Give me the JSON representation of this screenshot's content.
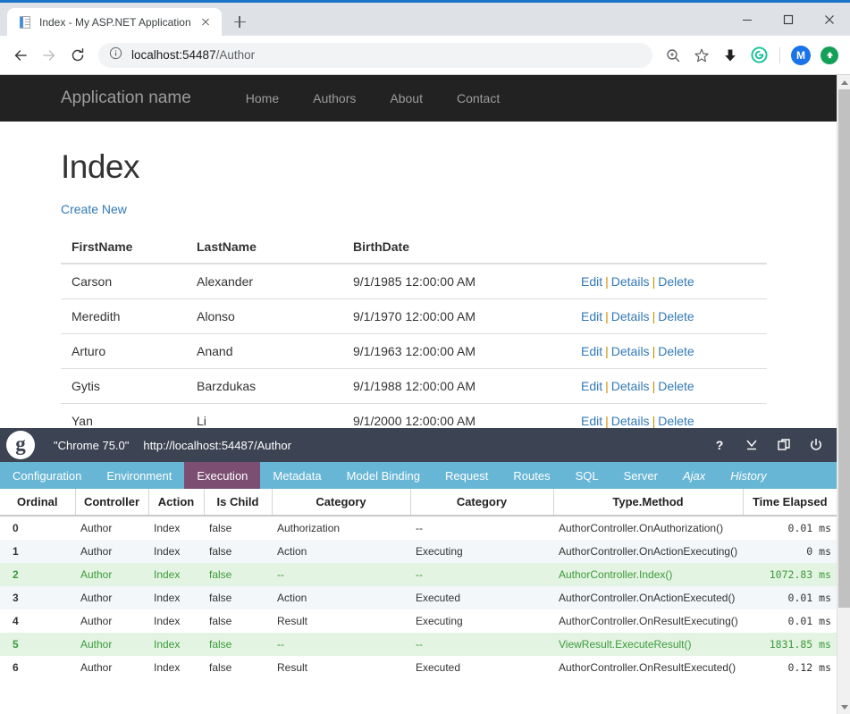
{
  "browser": {
    "tab": {
      "title": "Index - My ASP.NET Application",
      "favicon": "aspnet-document-icon",
      "close": "×"
    },
    "new_tab_tooltip": "New Tab",
    "window_controls": {
      "minimize": "minimize-icon",
      "maximize": "maximize-icon",
      "close": "close-icon"
    },
    "nav": {
      "back": "back-arrow-icon",
      "forward": "forward-arrow-icon",
      "reload": "reload-icon"
    },
    "omnibox": {
      "info_icon": "info-circle-icon",
      "host": "localhost:54487",
      "path": "/Author",
      "full_url": "localhost:54487/Author"
    },
    "toolbar_icons": [
      {
        "name": "zoom-icon",
        "glyph": "search-plus"
      },
      {
        "name": "bookmark-star-icon",
        "glyph": "star"
      },
      {
        "name": "download-icon",
        "glyph": "down-arrow"
      },
      {
        "name": "grammarly-extension-icon",
        "glyph": "G",
        "color": "#15c39a"
      },
      {
        "name": "profile-avatar",
        "glyph": "M",
        "color": "#1a73e8"
      },
      {
        "name": "update-chrome-icon",
        "glyph": "▲",
        "color": "#15a05a"
      }
    ]
  },
  "site": {
    "brand": "Application name",
    "nav_links": [
      "Home",
      "Authors",
      "About",
      "Contact"
    ]
  },
  "page": {
    "title": "Index",
    "create_new_label": "Create New",
    "table": {
      "headers": [
        "FirstName",
        "LastName",
        "BirthDate",
        ""
      ],
      "action_labels": {
        "edit": "Edit",
        "details": "Details",
        "delete": "Delete",
        "separator": "|"
      },
      "rows": [
        {
          "first": "Carson",
          "last": "Alexander",
          "birth": "9/1/1985 12:00:00 AM"
        },
        {
          "first": "Meredith",
          "last": "Alonso",
          "birth": "9/1/1970 12:00:00 AM"
        },
        {
          "first": "Arturo",
          "last": "Anand",
          "birth": "9/1/1963 12:00:00 AM"
        },
        {
          "first": "Gytis",
          "last": "Barzdukas",
          "birth": "9/1/1988 12:00:00 AM"
        },
        {
          "first": "Yan",
          "last": "Li",
          "birth": "9/1/2000 12:00:00 AM"
        }
      ]
    }
  },
  "glimpse": {
    "logo": "glimpse-logo",
    "browser_label": "\"Chrome 75.0\"",
    "url": "http://localhost:54487/Author",
    "header_icons": [
      {
        "name": "help-icon",
        "glyph": "?"
      },
      {
        "name": "minimize-panel-icon",
        "glyph": "⊻"
      },
      {
        "name": "popout-window-icon",
        "glyph": "⧉"
      },
      {
        "name": "power-off-icon",
        "glyph": "⏻"
      }
    ],
    "tabs": [
      {
        "label": "Configuration",
        "active": false,
        "italic": false
      },
      {
        "label": "Environment",
        "active": false,
        "italic": false
      },
      {
        "label": "Execution",
        "active": true,
        "italic": false
      },
      {
        "label": "Metadata",
        "active": false,
        "italic": false
      },
      {
        "label": "Model Binding",
        "active": false,
        "italic": false
      },
      {
        "label": "Request",
        "active": false,
        "italic": false
      },
      {
        "label": "Routes",
        "active": false,
        "italic": false
      },
      {
        "label": "SQL",
        "active": false,
        "italic": false
      },
      {
        "label": "Server",
        "active": false,
        "italic": false
      },
      {
        "label": "Ajax",
        "active": false,
        "italic": true
      },
      {
        "label": "History",
        "active": false,
        "italic": true
      }
    ],
    "execution_table": {
      "headers": [
        "Ordinal",
        "Controller",
        "Action",
        "Is Child",
        "Category",
        "Category",
        "Type.Method",
        "Time Elapsed"
      ],
      "rows": [
        {
          "ordinal": "0",
          "controller": "Author",
          "action": "Index",
          "is_child": "false",
          "category1": "Authorization",
          "category2": "--",
          "type_method": "AuthorController.OnAuthorization()",
          "time": "0.01 ms",
          "highlight": false
        },
        {
          "ordinal": "1",
          "controller": "Author",
          "action": "Index",
          "is_child": "false",
          "category1": "Action",
          "category2": "Executing",
          "type_method": "AuthorController.OnActionExecuting()",
          "time": "0 ms",
          "highlight": false
        },
        {
          "ordinal": "2",
          "controller": "Author",
          "action": "Index",
          "is_child": "false",
          "category1": "--",
          "category2": "--",
          "type_method": "AuthorController.Index()",
          "time": "1072.83 ms",
          "highlight": true
        },
        {
          "ordinal": "3",
          "controller": "Author",
          "action": "Index",
          "is_child": "false",
          "category1": "Action",
          "category2": "Executed",
          "type_method": "AuthorController.OnActionExecuted()",
          "time": "0.01 ms",
          "highlight": false
        },
        {
          "ordinal": "4",
          "controller": "Author",
          "action": "Index",
          "is_child": "false",
          "category1": "Result",
          "category2": "Executing",
          "type_method": "AuthorController.OnResultExecuting()",
          "time": "0.01 ms",
          "highlight": false
        },
        {
          "ordinal": "5",
          "controller": "Author",
          "action": "Index",
          "is_child": "false",
          "category1": "--",
          "category2": "--",
          "type_method": "ViewResult.ExecuteResult()",
          "time": "1831.85 ms",
          "highlight": true
        },
        {
          "ordinal": "6",
          "controller": "Author",
          "action": "Index",
          "is_child": "false",
          "category1": "Result",
          "category2": "Executed",
          "type_method": "AuthorController.OnResultExecuted()",
          "time": "0.12 ms",
          "highlight": false
        }
      ]
    }
  },
  "colors": {
    "chrome_titlebar": "#dee1e6",
    "chrome_accent": "#1a73c8",
    "site_navbar": "#222222",
    "link_blue": "#337ab7",
    "glimpse_header": "#3c4352",
    "glimpse_tabs": "#67b6d5",
    "glimpse_active_tab": "#7b4e72",
    "glimpse_highlight_row": "#e4f4e2",
    "glimpse_highlight_text": "#3c9a3c"
  }
}
